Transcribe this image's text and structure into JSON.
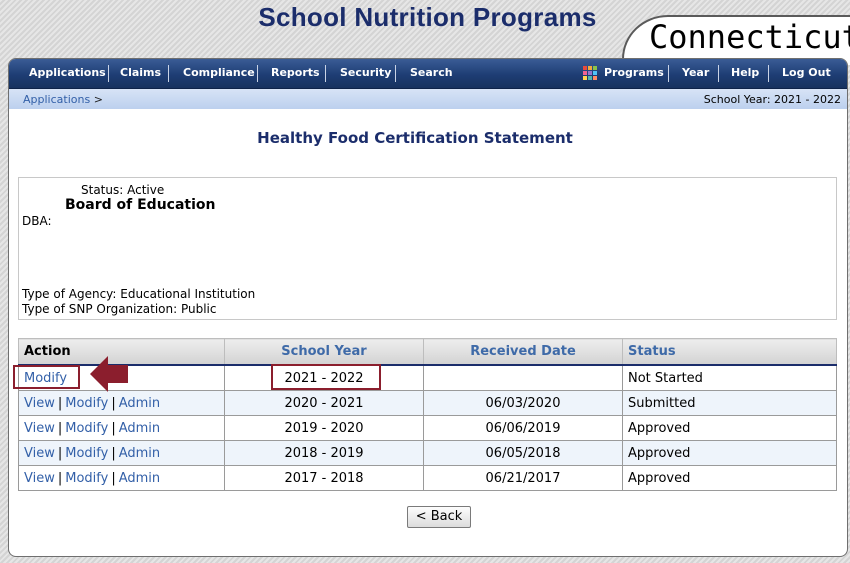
{
  "header": {
    "site_title": "School Nutrition Programs",
    "state_name": "Connecticut"
  },
  "nav": {
    "left": [
      "Applications",
      "Claims",
      "Compliance",
      "Reports",
      "Security",
      "Search"
    ],
    "right": [
      "Programs",
      "Year",
      "Help",
      "Log Out"
    ]
  },
  "breadcrumb": {
    "item": "Applications",
    "separator": ">"
  },
  "school_year_label": "School Year: 2021 - 2022",
  "page_heading": "Healthy Food Certification Statement",
  "org": {
    "status_line": "Status: Active",
    "name": "Board of Education",
    "dba": "DBA:",
    "agency_type": "Type of Agency: Educational Institution",
    "snp_org_type": "Type of SNP Organization: Public"
  },
  "table": {
    "headers": [
      "Action",
      "School Year",
      "Received Date",
      "Status"
    ],
    "rows": [
      {
        "actions": [
          "Modify"
        ],
        "year": "2021 - 2022",
        "received": "",
        "status": "Not Started"
      },
      {
        "actions": [
          "View",
          "Modify",
          "Admin"
        ],
        "year": "2020 - 2021",
        "received": "06/03/2020",
        "status": "Submitted"
      },
      {
        "actions": [
          "View",
          "Modify",
          "Admin"
        ],
        "year": "2019 - 2020",
        "received": "06/06/2019",
        "status": "Approved"
      },
      {
        "actions": [
          "View",
          "Modify",
          "Admin"
        ],
        "year": "2018 - 2019",
        "received": "06/05/2018",
        "status": "Approved"
      },
      {
        "actions": [
          "View",
          "Modify",
          "Admin"
        ],
        "year": "2017 - 2018",
        "received": "06/21/2017",
        "status": "Approved"
      }
    ]
  },
  "back_label": "< Back",
  "colors": {
    "navy": "#1b2d6b",
    "link": "#3360a8",
    "highlight": "#8b1e2d"
  }
}
